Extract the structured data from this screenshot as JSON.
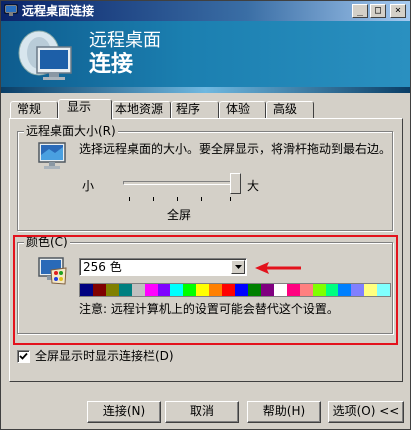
{
  "window": {
    "title": "远程桌面连接",
    "controls": {
      "minimize": "_",
      "maximize": "□",
      "close": "×"
    }
  },
  "banner": {
    "line1": "远程桌面",
    "line2": "连接",
    "icon": "remote-desktop-icon"
  },
  "tabs": [
    {
      "label": "常规",
      "active": false
    },
    {
      "label": "显示",
      "active": true
    },
    {
      "label": "本地资源",
      "active": false
    },
    {
      "label": "程序",
      "active": false
    },
    {
      "label": "体验",
      "active": false
    },
    {
      "label": "高级",
      "active": false
    }
  ],
  "size_group": {
    "legend": "远程桌面大小(R)",
    "description": "选择远程桌面的大小。要全屏显示，将滑杆拖动到最右边。",
    "slider_min_label": "小",
    "slider_max_label": "大",
    "slider_value_label": "全屏",
    "slider_position": 1.0,
    "icon": "monitor-icon"
  },
  "color_group": {
    "legend": "颜色(C)",
    "selected": "256 色",
    "note": "注意: 远程计算机上的设置可能会替代这个设置。",
    "icon": "palette-icon",
    "spectrum_colors": [
      "#000080",
      "#800000",
      "#808000",
      "#008080",
      "#c0c0c0",
      "#ff00ff",
      "#8000ff",
      "#00ffff",
      "#00ff00",
      "#ffff00",
      "#ff8000",
      "#ff0000",
      "#0000ff",
      "#008000",
      "#800080",
      "#ffffff",
      "#ff0080",
      "#ff8080",
      "#80ff00",
      "#00ff80",
      "#0080ff",
      "#8080ff",
      "#ffff80",
      "#80ffff"
    ]
  },
  "connection_bar_checkbox": {
    "label": "全屏显示时显示连接栏(D)",
    "checked": true
  },
  "buttons": {
    "connect": "连接(N)",
    "cancel": "取消",
    "help": "帮助(H)",
    "options": "选项(O) <<"
  },
  "colors": {
    "highlight": "#e3121c",
    "face": "#d4d0c8"
  }
}
